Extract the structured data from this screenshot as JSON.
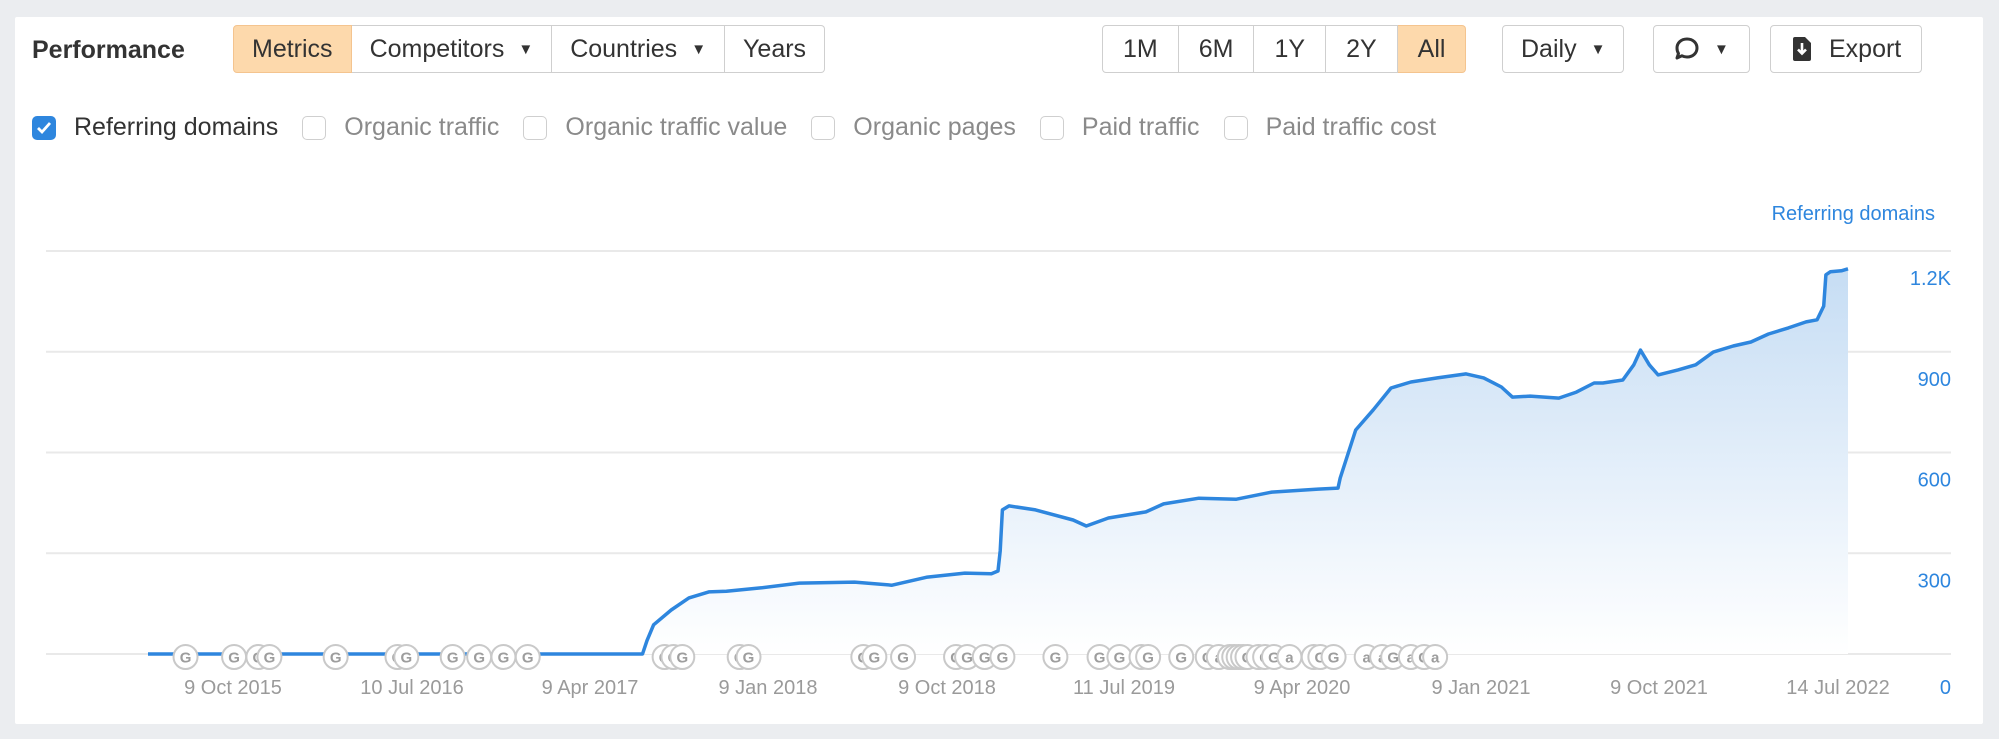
{
  "header": {
    "title": "Performance",
    "tabs": [
      {
        "label": "Metrics",
        "active": true,
        "dropdown": false
      },
      {
        "label": "Competitors",
        "active": false,
        "dropdown": true
      },
      {
        "label": "Countries",
        "active": false,
        "dropdown": true
      },
      {
        "label": "Years",
        "active": false,
        "dropdown": false
      }
    ],
    "ranges": [
      {
        "label": "1M",
        "active": false
      },
      {
        "label": "6M",
        "active": false
      },
      {
        "label": "1Y",
        "active": false
      },
      {
        "label": "2Y",
        "active": false
      },
      {
        "label": "All",
        "active": true
      }
    ],
    "interval": {
      "label": "Daily"
    },
    "annotations_icon": "speech-bubble-icon",
    "export": {
      "label": "Export",
      "icon": "download-file-icon"
    }
  },
  "metrics": [
    {
      "label": "Referring domains",
      "checked": true
    },
    {
      "label": "Organic traffic",
      "checked": false
    },
    {
      "label": "Organic traffic value",
      "checked": false
    },
    {
      "label": "Organic pages",
      "checked": false
    },
    {
      "label": "Paid traffic",
      "checked": false
    },
    {
      "label": "Paid traffic cost",
      "checked": false
    }
  ],
  "colors": {
    "accent": "#2e86de",
    "active_button": "#fdd9ac",
    "area_top": "#c6ddf4",
    "area_bottom": "#ffffff"
  },
  "chart_data": {
    "type": "area",
    "title": "",
    "series_label": "Referring domains",
    "ylabel": "Referring domains",
    "xlabel": "",
    "ylim": [
      0,
      1200
    ],
    "y_ticks": [
      {
        "value": 1200,
        "label": "1.2K"
      },
      {
        "value": 900,
        "label": "900"
      },
      {
        "value": 600,
        "label": "600"
      },
      {
        "value": 300,
        "label": "300"
      },
      {
        "value": 0,
        "label": "0"
      }
    ],
    "x_ticks": [
      "9 Oct 2015",
      "10 Jul 2016",
      "9 Apr 2017",
      "9 Jan 2018",
      "9 Oct 2018",
      "11 Jul 2019",
      "9 Apr 2020",
      "9 Jan 2021",
      "9 Oct 2021",
      "14 Jul 2022"
    ],
    "x_range_months": [
      -3.5,
      73.5
    ],
    "grid": true,
    "legend": "top-right",
    "series": [
      {
        "name": "Referring domains",
        "points_month_value": [
          [
            -3.5,
            0
          ],
          [
            0,
            0
          ],
          [
            6,
            0
          ],
          [
            12,
            0
          ],
          [
            18,
            0
          ],
          [
            18.9,
            0
          ],
          [
            19.1,
            40
          ],
          [
            19.4,
            87
          ],
          [
            20.2,
            131
          ],
          [
            21,
            167
          ],
          [
            21.9,
            185
          ],
          [
            22.7,
            187
          ],
          [
            24.3,
            197
          ],
          [
            26,
            211
          ],
          [
            28.5,
            214
          ],
          [
            30.2,
            205
          ],
          [
            31.8,
            229
          ],
          [
            33.5,
            241
          ],
          [
            34.7,
            239
          ],
          [
            35,
            247
          ],
          [
            35.1,
            307
          ],
          [
            35.2,
            429
          ],
          [
            35.5,
            441
          ],
          [
            36.7,
            429
          ],
          [
            38.4,
            399
          ],
          [
            39,
            381
          ],
          [
            40,
            405
          ],
          [
            41.7,
            423
          ],
          [
            42.5,
            447
          ],
          [
            44.1,
            464
          ],
          [
            45.8,
            461
          ],
          [
            47.4,
            482
          ],
          [
            49.5,
            491
          ],
          [
            50.4,
            494
          ],
          [
            50.5,
            524
          ],
          [
            51.2,
            667
          ],
          [
            52,
            727
          ],
          [
            52.8,
            792
          ],
          [
            53.7,
            810
          ],
          [
            54.9,
            822
          ],
          [
            56.2,
            834
          ],
          [
            57,
            822
          ],
          [
            57.8,
            795
          ],
          [
            58.3,
            765
          ],
          [
            59.1,
            768
          ],
          [
            60.4,
            762
          ],
          [
            61.2,
            780
          ],
          [
            62,
            807
          ],
          [
            62.4,
            807
          ],
          [
            63.3,
            816
          ],
          [
            63.8,
            861
          ],
          [
            64.1,
            905
          ],
          [
            64.5,
            861
          ],
          [
            64.9,
            831
          ],
          [
            65.8,
            846
          ],
          [
            66.6,
            861
          ],
          [
            67.4,
            899
          ],
          [
            68.3,
            917
          ],
          [
            69.1,
            929
          ],
          [
            69.9,
            953
          ],
          [
            70.8,
            971
          ],
          [
            71.6,
            989
          ],
          [
            72.1,
            995
          ],
          [
            72.4,
            1036
          ],
          [
            72.5,
            1129
          ],
          [
            72.7,
            1138
          ],
          [
            73.2,
            1141
          ],
          [
            73.5,
            1147
          ]
        ]
      }
    ],
    "event_markers": [
      {
        "month": -1.8,
        "label": "G"
      },
      {
        "month": 0.4,
        "label": "G"
      },
      {
        "month": 1.5,
        "label": "G"
      },
      {
        "month": 2,
        "label": "G"
      },
      {
        "month": 5,
        "label": "G"
      },
      {
        "month": 7.8,
        "label": "G"
      },
      {
        "month": 8.2,
        "label": "G"
      },
      {
        "month": 10.3,
        "label": "G"
      },
      {
        "month": 11.5,
        "label": "G"
      },
      {
        "month": 12.6,
        "label": "G"
      },
      {
        "month": 13.7,
        "label": "G"
      },
      {
        "month": 19.9,
        "label": "G"
      },
      {
        "month": 20.3,
        "label": "G"
      },
      {
        "month": 20.7,
        "label": "G"
      },
      {
        "month": 23.3,
        "label": "G"
      },
      {
        "month": 23.7,
        "label": "G"
      },
      {
        "month": 28.9,
        "label": "G"
      },
      {
        "month": 29.4,
        "label": "G"
      },
      {
        "month": 30.7,
        "label": "G"
      },
      {
        "month": 33.1,
        "label": "G"
      },
      {
        "month": 33.6,
        "label": "G"
      },
      {
        "month": 34.4,
        "label": "G"
      },
      {
        "month": 35.2,
        "label": "G"
      },
      {
        "month": 37.6,
        "label": "G"
      },
      {
        "month": 39.6,
        "label": "G"
      },
      {
        "month": 40.5,
        "label": "G"
      },
      {
        "month": 41.5,
        "label": "G"
      },
      {
        "month": 41.8,
        "label": "G"
      },
      {
        "month": 43.3,
        "label": "G"
      },
      {
        "month": 44.5,
        "label": "G"
      },
      {
        "month": 45,
        "label": "a"
      },
      {
        "month": 45.5,
        "label": "G"
      },
      {
        "month": 45.7,
        "label": "G"
      },
      {
        "month": 45.9,
        "label": "G"
      },
      {
        "month": 46.1,
        "label": "G"
      },
      {
        "month": 46.3,
        "label": "G"
      },
      {
        "month": 46.8,
        "label": "G"
      },
      {
        "month": 47.1,
        "label": "G"
      },
      {
        "month": 47.5,
        "label": "G"
      },
      {
        "month": 48.2,
        "label": "a"
      },
      {
        "month": 49.3,
        "label": "G"
      },
      {
        "month": 49.6,
        "label": "G"
      },
      {
        "month": 50.2,
        "label": "G"
      },
      {
        "month": 51.7,
        "label": "a"
      },
      {
        "month": 52.4,
        "label": "a"
      },
      {
        "month": 52.9,
        "label": "G"
      },
      {
        "month": 53.7,
        "label": "a"
      },
      {
        "month": 54.3,
        "label": "G"
      },
      {
        "month": 54.8,
        "label": "a"
      }
    ]
  }
}
